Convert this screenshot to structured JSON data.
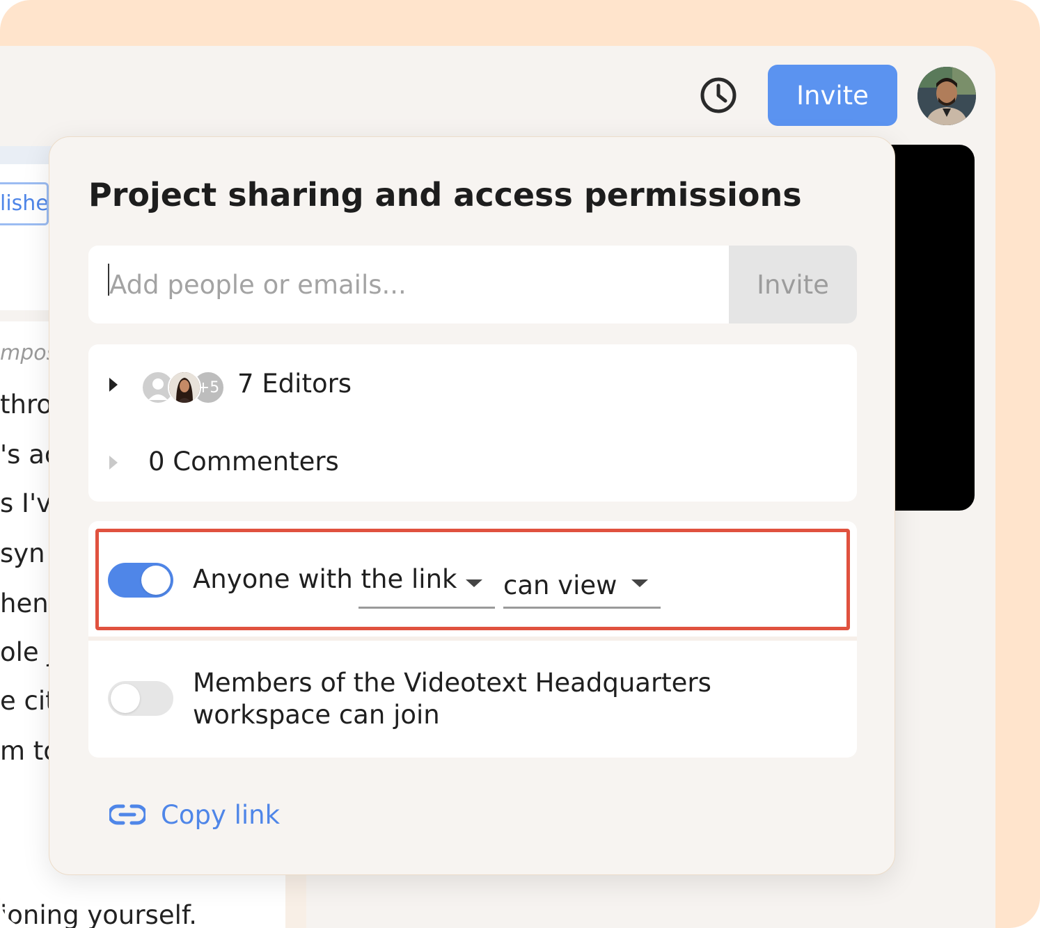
{
  "topbar": {
    "invite_label": "Invite"
  },
  "background_doc": {
    "tab_label": "lishe",
    "lines": [
      {
        "text": "mpos",
        "italic": true
      },
      {
        "text": "thro",
        "italic": false
      },
      {
        "text": "'s ac",
        "italic": false
      },
      {
        "text": "s I'v",
        "italic": false
      },
      {
        "text": "syn",
        "italic": false
      },
      {
        "text": "hen ",
        "italic": false
      },
      {
        "text": "ole ju",
        "italic": false
      },
      {
        "text": "e cit",
        "italic": false
      },
      {
        "text": "m to",
        "italic": false
      }
    ],
    "bottom_line": "ioning yourself."
  },
  "dialog": {
    "title": "Project sharing and access permissions",
    "invite_placeholder": "Add people or emails...",
    "invite_button": "Invite",
    "editors": {
      "label": "7 Editors",
      "extra_count": "+5"
    },
    "commenters": {
      "label": "0 Commenters"
    },
    "link_access": {
      "enabled": true,
      "who": "Anyone with the link",
      "permission": "can view"
    },
    "workspace_access": {
      "enabled": false,
      "label_line1": "Members of the Videotext Headquarters",
      "label_line2": "workspace can join"
    },
    "copy_link_label": "Copy link"
  },
  "colors": {
    "accent": "#4f86e8",
    "invite_button": "#5b93f0",
    "highlight": "#e0523f",
    "frame": "#ffe4cc"
  }
}
